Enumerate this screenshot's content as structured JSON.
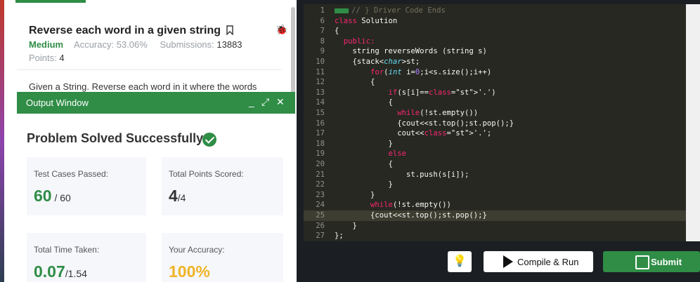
{
  "problem": {
    "title": "Reverse each word in a given string",
    "difficulty": "Medium",
    "accuracy_label": "Accuracy:",
    "accuracy_value": "53.06%",
    "submissions_label": "Submissions:",
    "submissions_value": "13883",
    "points_label": "Points:",
    "points_value": "4",
    "description": "Given a String. Reverse each word in it where the words"
  },
  "output_window": {
    "title": "Output Window",
    "minimize": "_",
    "expand": "⤢",
    "close": "✕",
    "status": "Problem Solved Successfully",
    "cards": {
      "test_cases": {
        "label": "Test Cases Passed:",
        "value": "60",
        "total": " / 60"
      },
      "points": {
        "label": "Total Points Scored:",
        "value": "4",
        "total": "/4"
      },
      "time": {
        "label": "Total Time Taken:",
        "value": "0.07",
        "total": "/1.54"
      },
      "accuracy": {
        "label": "Your Accuracy:",
        "value": "100%"
      }
    }
  },
  "editor": {
    "lines": [
      {
        "n": "1",
        "prefix": "",
        "text": "// } Driver Code Ends"
      },
      {
        "n": "6",
        "prefix": "",
        "text": "class Solution"
      },
      {
        "n": "7",
        "prefix": "",
        "text": "{"
      },
      {
        "n": "8",
        "prefix": "  ",
        "text": "public:"
      },
      {
        "n": "9",
        "prefix": "    ",
        "text": "string reverseWords (string s)"
      },
      {
        "n": "10",
        "prefix": "    ",
        "text": "{stack<char>st;"
      },
      {
        "n": "11",
        "prefix": "        ",
        "text": "for(int i=0;i<s.size();i++)"
      },
      {
        "n": "12",
        "prefix": "        ",
        "text": "{"
      },
      {
        "n": "13",
        "prefix": "            ",
        "text": "if(s[i]=='.')"
      },
      {
        "n": "14",
        "prefix": "            ",
        "text": "{"
      },
      {
        "n": "15",
        "prefix": "              ",
        "text": "while(!st.empty())"
      },
      {
        "n": "16",
        "prefix": "              ",
        "text": "{cout<<st.top();st.pop();}"
      },
      {
        "n": "17",
        "prefix": "              ",
        "text": "cout<<'.';"
      },
      {
        "n": "18",
        "prefix": "            ",
        "text": "}"
      },
      {
        "n": "19",
        "prefix": "            ",
        "text": "else"
      },
      {
        "n": "20",
        "prefix": "            ",
        "text": "{"
      },
      {
        "n": "21",
        "prefix": "                ",
        "text": "st.push(s[i]);"
      },
      {
        "n": "22",
        "prefix": "            ",
        "text": "}"
      },
      {
        "n": "23",
        "prefix": "        ",
        "text": "}"
      },
      {
        "n": "24",
        "prefix": "        ",
        "text": "while(!st.empty())"
      },
      {
        "n": "25",
        "prefix": "        ",
        "text": "{cout<<st.top();st.pop();}"
      },
      {
        "n": "26",
        "prefix": "    ",
        "text": "}"
      },
      {
        "n": "27",
        "prefix": "",
        "text": "};"
      }
    ],
    "highlight_line": "25"
  },
  "toolbar": {
    "compile_label": "Compile & Run",
    "submit_label": "Submit"
  },
  "colors": {
    "accent": "#2f8d46",
    "test_cases_value": "#2f8d46",
    "points_value": "#333333",
    "time_value": "#2f8d46",
    "accuracy_value": "#f0b429"
  }
}
